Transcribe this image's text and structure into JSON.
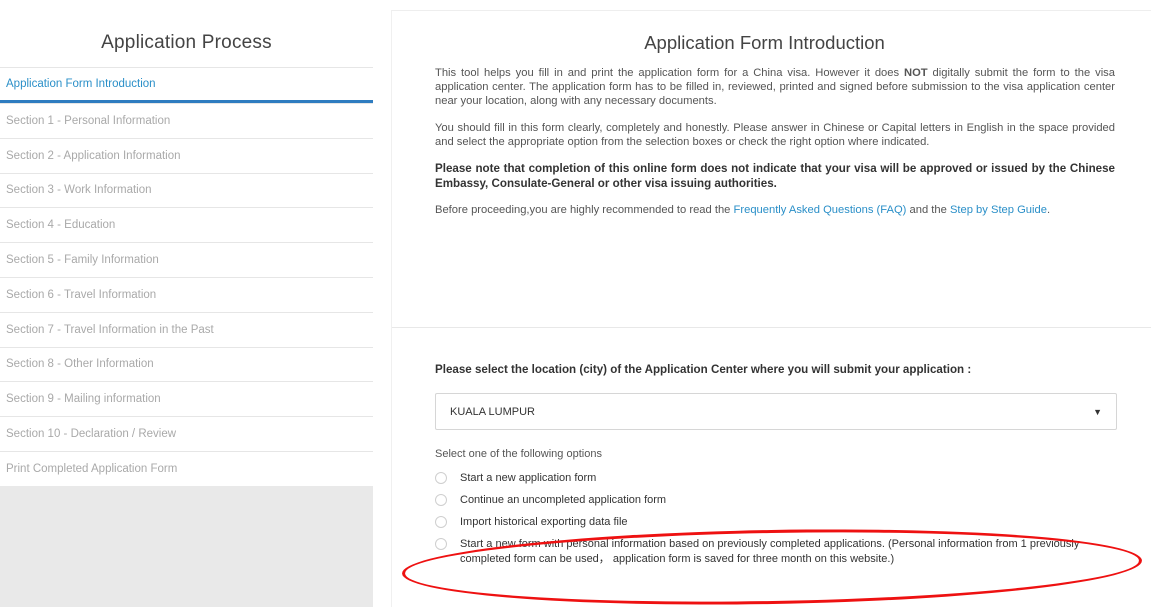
{
  "sidebar": {
    "title": "Application Process",
    "items": [
      {
        "label": "Application Form Introduction"
      },
      {
        "label": "Section 1 - Personal Information"
      },
      {
        "label": "Section 2 - Application Information"
      },
      {
        "label": "Section 3 - Work Information"
      },
      {
        "label": "Section 4 - Education"
      },
      {
        "label": "Section 5 - Family Information"
      },
      {
        "label": "Section 6 - Travel Information"
      },
      {
        "label": "Section 7 - Travel Information in the Past"
      },
      {
        "label": "Section 8 - Other Information"
      },
      {
        "label": "Section 9 - Mailing information"
      },
      {
        "label": "Section 10 - Declaration / Review"
      },
      {
        "label": "Print Completed Application Form"
      }
    ]
  },
  "main": {
    "title": "Application Form Introduction",
    "intro_p1_a": "This tool helps you fill in and print the application form for a China visa. However it does ",
    "intro_p1_not": "NOT",
    "intro_p1_b": " digitally submit the form to the visa application center. The application form has to be filled in, reviewed, printed and signed before submission to the visa application center near your location, along with any necessary documents.",
    "intro_p2": "You should fill in this form clearly, completely and honestly. Please answer in Chinese or Capital letters in English in the space provided and select the appropriate option from the selection boxes or check the right option where indicated.",
    "intro_p3": "Please note that completion of this online form does not indicate that your visa will be approved or issued by the Chinese Embassy, Consulate-General or other visa issuing authorities.",
    "intro_p4_a": "Before proceeding,you are highly recommended to read the ",
    "faq_link": "Frequently Asked Questions (FAQ)",
    "intro_p4_b": " and the ",
    "guide_link": "Step by Step Guide",
    "intro_p4_c": ".",
    "location_label": "Please select the location (city) of the Application Center where you will submit your application :",
    "location_value": "KUALA LUMPUR",
    "options_label": "Select one of the following options",
    "options": [
      {
        "label": "Start a new application form"
      },
      {
        "label": "Continue an uncompleted application form"
      },
      {
        "label": "Import historical exporting data file"
      },
      {
        "label": "Start a new form with personal information based on previously completed applications. (Personal information from 1 previously completed form can be used， application form is saved for three month on this website.)"
      }
    ]
  },
  "colors": {
    "accent": "#2a8fc8",
    "highlight_circle": "#e11111"
  }
}
